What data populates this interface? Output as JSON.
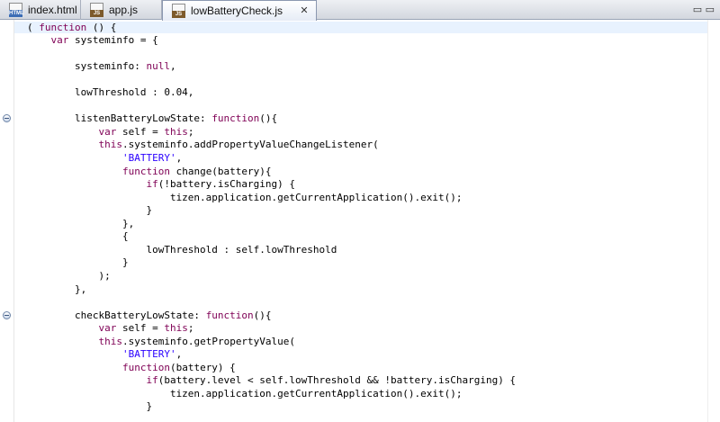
{
  "tabs": [
    {
      "label": "index.html",
      "icon": "html-file-icon",
      "badge": "HTML",
      "active": false
    },
    {
      "label": "app.js",
      "icon": "js-file-icon",
      "badge": "JS",
      "active": false
    },
    {
      "label": "lowBatteryCheck.js",
      "icon": "js-file-icon",
      "badge": "JS",
      "active": true
    }
  ],
  "close_glyph": "✕",
  "window_controls": "▭ ▭",
  "colors": {
    "keyword": "#7f0055",
    "string": "#2a00ff",
    "current_line": "#e8f2fe"
  },
  "code": [
    [
      [
        "( ",
        ""
      ],
      [
        "function",
        "kw"
      ],
      [
        " () {",
        ""
      ]
    ],
    [
      [
        "    ",
        ""
      ],
      [
        "var",
        "kw"
      ],
      [
        " systeminfo = {",
        ""
      ]
    ],
    [
      [
        "",
        ""
      ]
    ],
    [
      [
        "        systeminfo: ",
        ""
      ],
      [
        "null",
        "kw"
      ],
      [
        ",",
        ""
      ]
    ],
    [
      [
        "",
        ""
      ]
    ],
    [
      [
        "        lowThreshold : 0.04,",
        ""
      ]
    ],
    [
      [
        "",
        ""
      ]
    ],
    [
      [
        "        listenBatteryLowState: ",
        ""
      ],
      [
        "function",
        "kw"
      ],
      [
        "(){",
        ""
      ]
    ],
    [
      [
        "            ",
        ""
      ],
      [
        "var",
        "kw"
      ],
      [
        " self = ",
        ""
      ],
      [
        "this",
        "kw"
      ],
      [
        ";",
        ""
      ]
    ],
    [
      [
        "            ",
        ""
      ],
      [
        "this",
        "kw"
      ],
      [
        ".systeminfo.addPropertyValueChangeListener(",
        ""
      ]
    ],
    [
      [
        "                ",
        ""
      ],
      [
        "'BATTERY'",
        "str"
      ],
      [
        ",",
        ""
      ]
    ],
    [
      [
        "                ",
        ""
      ],
      [
        "function",
        "kw"
      ],
      [
        " change(battery){",
        ""
      ]
    ],
    [
      [
        "                    ",
        ""
      ],
      [
        "if",
        "kw"
      ],
      [
        "(!battery.isCharging) {",
        ""
      ]
    ],
    [
      [
        "                        tizen.application.getCurrentApplication().exit();",
        ""
      ]
    ],
    [
      [
        "                    }",
        ""
      ]
    ],
    [
      [
        "                },",
        ""
      ]
    ],
    [
      [
        "                {",
        ""
      ]
    ],
    [
      [
        "                    lowThreshold : self.lowThreshold",
        ""
      ]
    ],
    [
      [
        "                }",
        ""
      ]
    ],
    [
      [
        "            );",
        ""
      ]
    ],
    [
      [
        "        },",
        ""
      ]
    ],
    [
      [
        "",
        ""
      ]
    ],
    [
      [
        "        checkBatteryLowState: ",
        ""
      ],
      [
        "function",
        "kw"
      ],
      [
        "(){",
        ""
      ]
    ],
    [
      [
        "            ",
        ""
      ],
      [
        "var",
        "kw"
      ],
      [
        " self = ",
        ""
      ],
      [
        "this",
        "kw"
      ],
      [
        ";",
        ""
      ]
    ],
    [
      [
        "            ",
        ""
      ],
      [
        "this",
        "kw"
      ],
      [
        ".systeminfo.getPropertyValue(",
        ""
      ]
    ],
    [
      [
        "                ",
        ""
      ],
      [
        "'BATTERY'",
        "str"
      ],
      [
        ",",
        ""
      ]
    ],
    [
      [
        "                ",
        ""
      ],
      [
        "function",
        "kw"
      ],
      [
        "(battery) {",
        ""
      ]
    ],
    [
      [
        "                    ",
        ""
      ],
      [
        "if",
        "kw"
      ],
      [
        "(battery.level < self.lowThreshold && !battery.isCharging) {",
        ""
      ]
    ],
    [
      [
        "                        tizen.application.getCurrentApplication().exit();",
        ""
      ]
    ],
    [
      [
        "                    }",
        ""
      ]
    ]
  ],
  "fold_lines": [
    7,
    22
  ]
}
